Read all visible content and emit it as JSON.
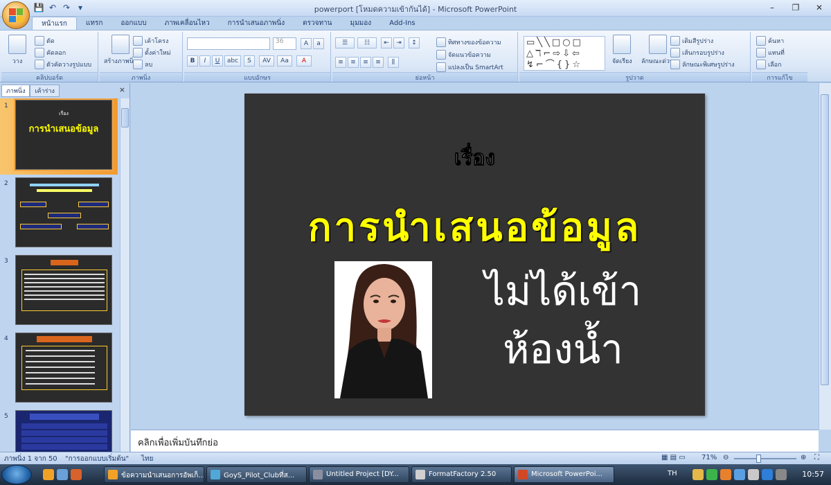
{
  "window": {
    "title": "powerport [โหมดความเข้ากันได้] - Microsoft PowerPoint",
    "controls": [
      "–",
      "❐",
      "✕"
    ]
  },
  "quick_access": [
    "💾",
    "↶",
    "↷",
    "▾"
  ],
  "tabs": [
    "หน้าแรก",
    "แทรก",
    "ออกแบบ",
    "ภาพเคลื่อนไหว",
    "การนำเสนอภาพนิ่ง",
    "ตรวจทาน",
    "มุมมอง",
    "Add-Ins"
  ],
  "ribbon": {
    "groups": {
      "clipboard": {
        "label": "คลิปบอร์ด",
        "paste": "วาง",
        "cut": "ตัด",
        "copy": "คัดลอก",
        "format": "ตัวคัดวางรูปแบบ"
      },
      "slides": {
        "label": "ภาพนิ่ง",
        "new_slide": "สร้างภาพนิ่ง",
        "layout": "เค้าโครง",
        "reset": "ตั้งค่าใหม่",
        "delete": "ลบ"
      },
      "font": {
        "label": "แบบอักษร",
        "size": "36"
      },
      "paragraph": {
        "label": "ย่อหน้า",
        "text_dir": "ทิศทางของข้อความ",
        "align_text": "จัดแนวข้อความ",
        "smartart": "แปลงเป็น SmartArt"
      },
      "drawing": {
        "label": "รูปวาด",
        "arrange": "จัดเรียง",
        "quick_styles": "ลักษณะด่วน",
        "fill": "เติมสีรูปร่าง",
        "outline": "เส้นกรอบรูปร่าง",
        "effects": "ลักษณะพิเศษรูปร่าง"
      },
      "editing": {
        "label": "การแก้ไข",
        "find": "ค้นหา",
        "replace": "แทนที่",
        "select": "เลือก"
      }
    }
  },
  "left_pane": {
    "tabs": [
      "ภาพนิ่ง",
      "เค้าร่าง"
    ],
    "close": "×",
    "slide_numbers": [
      "1",
      "2",
      "3",
      "4",
      "5"
    ],
    "thumb1_small": "เรื่อง",
    "thumb1_title": "การนำเสนอข้อมูล"
  },
  "slide": {
    "subtitle": "เรื่อง",
    "title": "การนำเสนอข้อมูล",
    "overlay_line1": "ไม่ได้เข้า",
    "overlay_line2": "ห้องน้ำ"
  },
  "notes": {
    "placeholder": "คลิกเพื่อเพิ่มบันทึกย่อ"
  },
  "status": {
    "slide_info": "ภาพนิ่ง 1 จาก 50",
    "theme": "\"การออกแบบเริ่มต้น\"",
    "language": "ไทย",
    "zoom": "71%"
  },
  "taskbar": {
    "tasks": [
      "ข้อความนำเสนอการอัพเก็...",
      "GoyS_Pilot_Clubที่ส...",
      "Untitled Project [DY...",
      "FormatFactory 2.50",
      "Microsoft PowerPoi..."
    ],
    "clock": "10:57",
    "tray_lang": "TH"
  },
  "colors": {
    "slide_bg": "#333333",
    "title": "#ffff00",
    "text": "#ffffff"
  }
}
